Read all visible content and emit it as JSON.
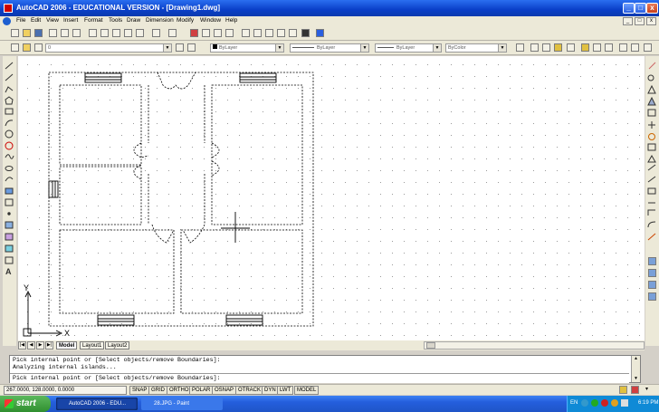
{
  "window": {
    "title": "AutoCAD 2006 - EDUCATIONAL VERSION - [Drawing1.dwg]",
    "controls": [
      "_",
      "□",
      "x"
    ],
    "doc_controls": [
      "_",
      "□",
      "x"
    ]
  },
  "menu": [
    "File",
    "Edit",
    "View",
    "Insert",
    "Format",
    "Tools",
    "Draw",
    "Dimension",
    "Modify",
    "Window",
    "Help"
  ],
  "toolbar": {
    "layer_value": "0",
    "color_value": "ByLayer",
    "linetype_value": "ByLayer",
    "lineweight_value": "ByLayer",
    "plotstyle_value": "ByColor"
  },
  "left_toolbar_text_icon": "A",
  "ucs": {
    "x": "X",
    "y": "Y"
  },
  "layout_tabs": [
    "Model",
    "Layout1",
    "Layout2"
  ],
  "command": {
    "lines": [
      "Pick internal point or [Select objects/remove Boundaries]:",
      "Analyzing internal islands..."
    ],
    "prompt": "Pick internal point or [Select objects/remove Boundaries]:"
  },
  "status": {
    "coords": "267.0000, 128.0000, 0.0000",
    "toggles": [
      "SNAP",
      "GRID",
      "ORTHO",
      "POLAR",
      "OSNAP",
      "OTRACK",
      "DYN",
      "LWT",
      "MODEL"
    ]
  },
  "taskbar": {
    "start": "start",
    "tasks": [
      "AutoCAD 2006 - EDU...",
      "28.JPG - Paint"
    ],
    "lang": "EN",
    "time": "6:19 PM"
  },
  "colors": {
    "title": "#0a3fc8",
    "canvas": "#ffffff",
    "taskbar": "#245edc",
    "start": "#2f8f2f"
  }
}
